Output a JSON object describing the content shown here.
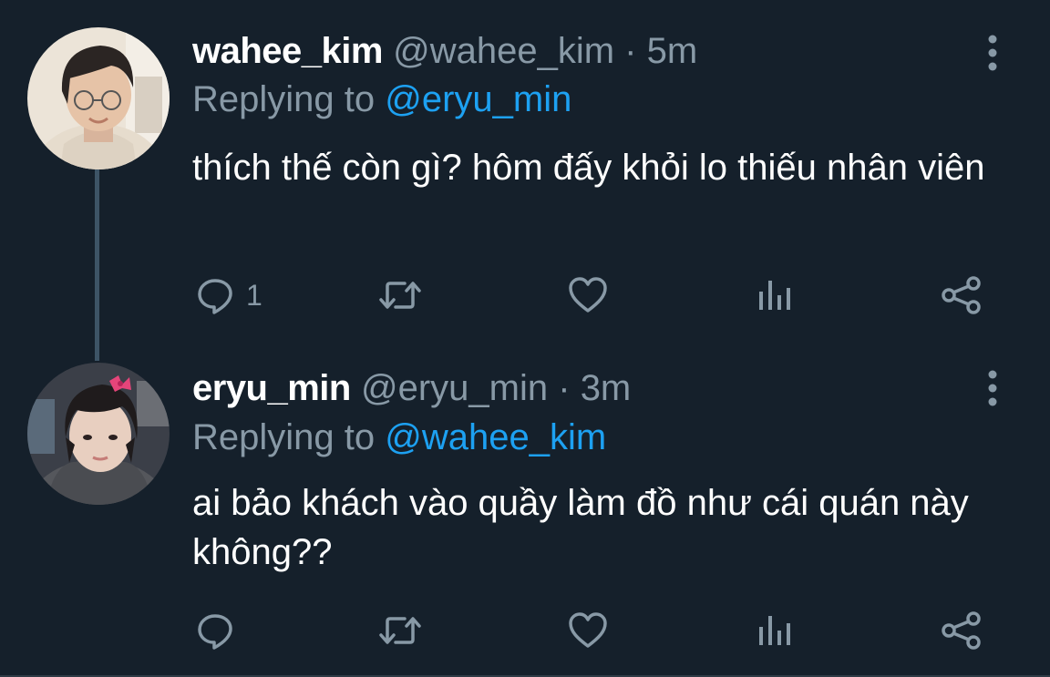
{
  "tweets": [
    {
      "display_name": "wahee_kim",
      "handle": "@wahee_kim",
      "separator": "·",
      "time": "5m",
      "replying_prefix": "Replying to",
      "replying_to": "@eryu_min",
      "text": "thích thế còn gì? hôm đấy khỏi lo thiếu nhân viên",
      "reply_count": "1",
      "avatar_icon": "person-photo-avatar"
    },
    {
      "display_name": "eryu_min",
      "handle": "@eryu_min",
      "separator": "·",
      "time": "3m",
      "replying_prefix": "Replying to",
      "replying_to": "@wahee_kim",
      "text": "ai bảo khách vào quầy làm đồ như cái quán này không??",
      "reply_count": "",
      "avatar_icon": "person-photo-avatar"
    }
  ],
  "icons": {
    "more": "vertical-dots-icon",
    "reply": "reply-bubble-icon",
    "retweet": "retweet-icon",
    "like": "heart-icon",
    "stats": "analytics-bars-icon",
    "share": "share-icon"
  },
  "colors": {
    "background": "#15202b",
    "text": "#ffffff",
    "secondary": "#8899a6",
    "link": "#1da1f2",
    "thread_line": "#3d5466"
  }
}
